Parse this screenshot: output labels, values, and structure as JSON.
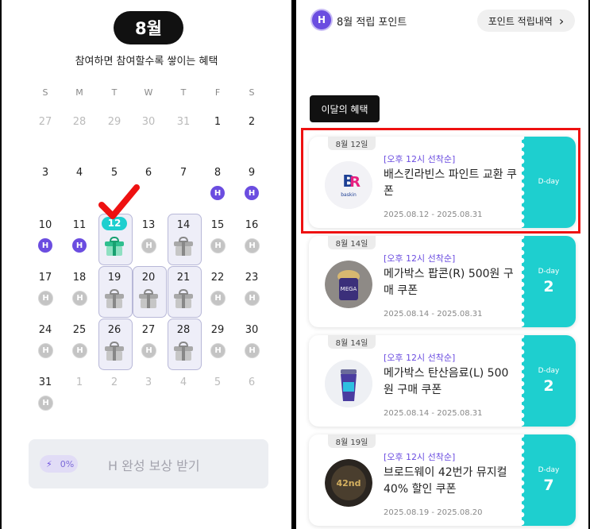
{
  "calendar": {
    "month_label": "8월",
    "subtitle": "참여하면 참여할수록 쌓이는 혜택",
    "weekdays": [
      "S",
      "M",
      "T",
      "W",
      "T",
      "F",
      "S"
    ],
    "prev_month_days": [
      "27",
      "28",
      "29",
      "30",
      "31"
    ],
    "days": [
      "1",
      "2",
      "3",
      "4",
      "5",
      "6",
      "7",
      "8",
      "9",
      "10",
      "11",
      "12",
      "13",
      "14",
      "15",
      "16",
      "17",
      "18",
      "19",
      "20",
      "21",
      "22",
      "23",
      "24",
      "25",
      "26",
      "27",
      "28",
      "29",
      "30",
      "31"
    ],
    "next_month_days": [
      "1",
      "2",
      "3",
      "4",
      "5",
      "6"
    ],
    "badge_letter": "H",
    "stamped_days": [
      "8",
      "9",
      "10",
      "11"
    ],
    "gift_days": [
      "12",
      "14",
      "19",
      "20",
      "21",
      "26",
      "28"
    ],
    "today": "12",
    "colors": {
      "accent": "#6b4de0",
      "teal": "#1ecfcf",
      "check": "#e11"
    }
  },
  "reward": {
    "percent": "0%",
    "label": "H 완성 보상 받기"
  },
  "points": {
    "logo_letter": "H",
    "title": "8월 적립 포인트",
    "history_button": "포인트 적립내역",
    "history_chevron": "›"
  },
  "benefits": {
    "section_tag": "이달의 혜택",
    "coupons": [
      {
        "date_tab": "8월 12일",
        "tag": "[오후 12시 선착순]",
        "name": "배스킨라빈스 파인트 교환 쿠폰",
        "period": "2025.08.12 - 2025.08.31",
        "dday_label": "D-day",
        "dday_num": "",
        "thumb": "baskin-robbins-logo"
      },
      {
        "date_tab": "8월 14일",
        "tag": "[오후 12시 선착순]",
        "name": "메가박스 팝콘(R) 500원 구매 쿠폰",
        "period": "2025.08.14 - 2025.08.31",
        "dday_label": "D-day",
        "dday_num": "2",
        "thumb": "megabox-popcorn"
      },
      {
        "date_tab": "8월 14일",
        "tag": "[오후 12시 선착순]",
        "name": "메가박스 탄산음료(L) 500원 구매 쿠폰",
        "period": "2025.08.14 - 2025.08.31",
        "dday_label": "D-day",
        "dday_num": "2",
        "thumb": "megabox-drink-cup"
      },
      {
        "date_tab": "8월 19일",
        "tag": "[오후 12시 선착순]",
        "name": "브로드웨이 42번가 뮤지컬 40% 할인 쿠폰",
        "period": "2025.08.19 - 2025.08.20",
        "dday_label": "D-day",
        "dday_num": "7",
        "thumb": "musical-poster"
      }
    ]
  }
}
